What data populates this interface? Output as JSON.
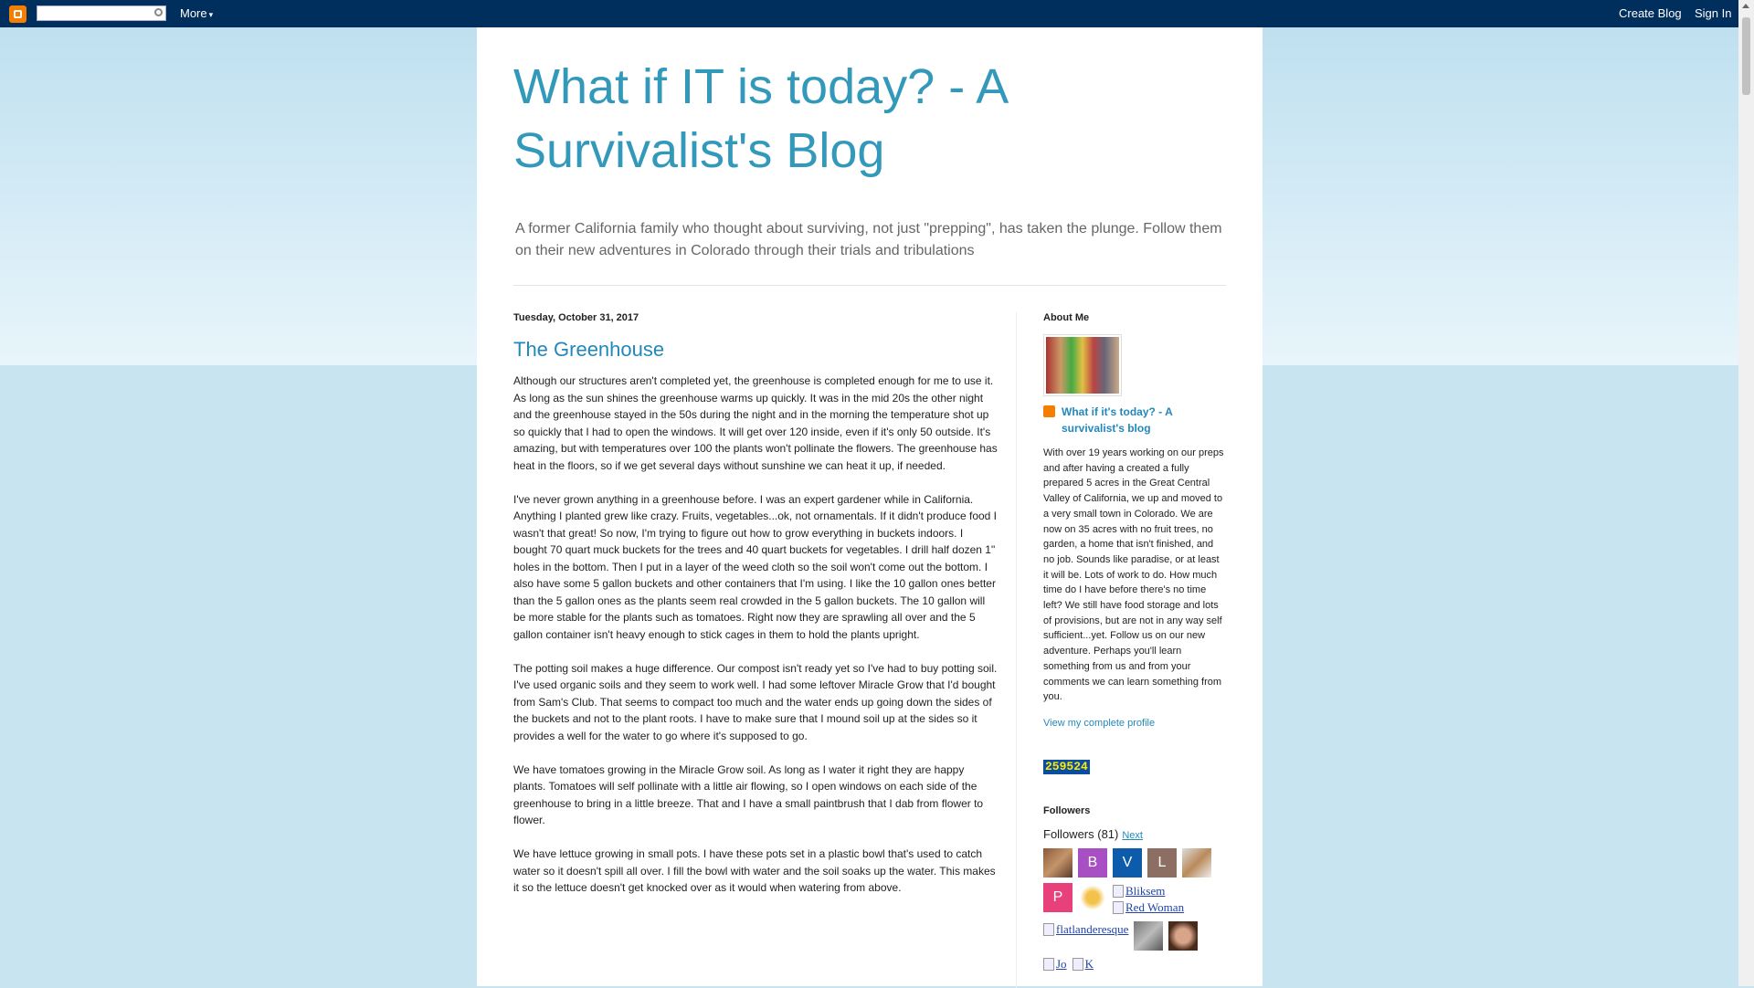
{
  "navbar": {
    "more_label": "More",
    "create_blog_label": "Create Blog",
    "sign_in_label": "Sign In"
  },
  "header": {
    "title": "What if IT is today? - A Survivalist's Blog",
    "description": "A former California family who thought about surviving, not just \"prepping\", has taken the plunge. Follow them on their new adventures in Colorado through their trials and tribulations"
  },
  "post": {
    "date": "Tuesday, October 31, 2017",
    "title": "The Greenhouse",
    "paragraphs": [
      "Although our structures aren't completed yet, the greenhouse is completed enough for me to use it.  As long as the sun shines the greenhouse warms up quickly.  It was in the mid 20s the other night and the greenhouse stayed in the 50s during the night and in the morning the temperature shot up so quickly that I had to open the windows. It will get over 120 inside, even if it's only 50 outside.  It's amazing, but with temperatures over 100 the plants won't pollinate the flowers. The greenhouse has heat in the floors, so if we get several days without sunshine we can heat it up, if needed.",
      "I've never grown anything in a greenhouse before.  I was an expert gardener while in California.  Anything I planted grew like crazy.  Fruits, vegetables...ok, not ornamentals.  If it didn't produce food I wasn't that great!  So now, I'm trying to figure out how to grow everything in buckets indoors.  I bought 70 quart muck buckets for the trees and 40 quart buckets for vegetables.  I drill half dozen 1\" holes in the bottom.  Then I put in a layer of the weed cloth so the soil won't come out the bottom.  I also have some 5 gallon buckets and other containers that I'm using.  I like the 10 gallon ones better than the 5 gallon ones as the plants seem real crowded in the 5 gallon buckets.  The 10 gallon will be more stable for the plants such as tomatoes.  Right now they are sprawling all over and the 5 gallon container isn't heavy enough to stick cages in them to hold the plants upright.",
      "The potting soil makes a huge difference.  Our compost isn't ready yet so I've had to buy potting soil.  I've used organic soils and they seem to work well.  I had some leftover Miracle Grow that I'd bought from Sam's Club.  That seems to compact too much and the water ends up going down the sides of the buckets and not to the plant roots.  I have to make sure that I mound soil up at the sides so it provides a well for the water to go where it's supposed to go.",
      "We have tomatoes growing in the Miracle Grow soil.  As long as I water it right they are happy plants.  Tomatoes will self pollinate with a little air flowing, so I open windows on each side of the greenhouse to bring in a little breeze.  That and I have a small paintbrush that I dab from flower to flower.",
      "We have lettuce growing in small pots.  I have these pots set in a plastic bowl that's used to catch water so it doesn't spill all over.  I fill the bowl with water and the soil soaks up the water.  This makes it so the lettuce doesn't get knocked over as it would when watering from above."
    ]
  },
  "sidebar": {
    "about_title": "About Me",
    "profile_name": "What if it's today? - A survivalist's blog",
    "profile_text": "With over 19 years working on our preps and after having a created a fully prepared 5 acres in the Great Central Valley of California, we up and moved to a very small town in Colorado. We are now on 35 acres with no fruit trees, no garden, a home that isn't finished, and no job. Sounds like paradise, or at least it will be. Lots of work to do. How much time do I have before there's no time left? We still have food storage and lots of provisions, but are not in any way self sufficient...yet. Follow us on our new adventure. Perhaps you'll learn something from us and from your comments we can learn something from you.",
    "profile_link": "View my complete profile",
    "counter": "259524",
    "followers_title": "Followers",
    "followers_label": "Followers (81)",
    "followers_next": "Next",
    "follower_letters": [
      "B",
      "V",
      "L",
      "P"
    ],
    "follower_colors": {
      "B": "#a94fc4",
      "V": "#0d5bab",
      "L": "#8d6e63",
      "P": "#e8407a"
    },
    "broken_images": [
      "Bliksem",
      "Red Woman",
      "flatlanderesque",
      "Jo",
      "K"
    ]
  }
}
